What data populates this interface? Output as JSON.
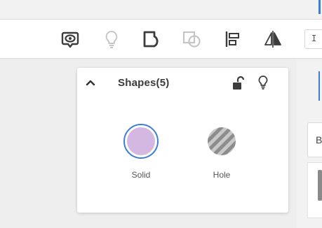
{
  "colors": {
    "accent": "#3d7fd8",
    "solid_fill": "#d4b8e2",
    "hole_stripe_dark": "#8c8c8c",
    "hole_stripe_light": "#c8c8c8",
    "icon_dark": "#3c3c3c",
    "icon_disabled": "#c5c5c5"
  },
  "toolbar": {
    "buttons": [
      {
        "name": "show-all-icon",
        "enabled": true
      },
      {
        "name": "lightbulb-icon",
        "enabled": false
      },
      {
        "name": "group-icon",
        "enabled": true
      },
      {
        "name": "ungroup-icon",
        "enabled": false
      },
      {
        "name": "align-icon",
        "enabled": true
      },
      {
        "name": "mirror-icon",
        "enabled": true
      }
    ],
    "partial_field_text": "I"
  },
  "right_panel": {
    "card_text": "B"
  },
  "shapes_panel": {
    "title": "Shapes(5)",
    "collapse_icon": "chevron-up-icon",
    "lock_icon": "unlock-icon",
    "visibility_icon": "lightbulb-icon",
    "options": [
      {
        "label": "Solid",
        "selected": true
      },
      {
        "label": "Hole",
        "selected": false
      }
    ]
  }
}
